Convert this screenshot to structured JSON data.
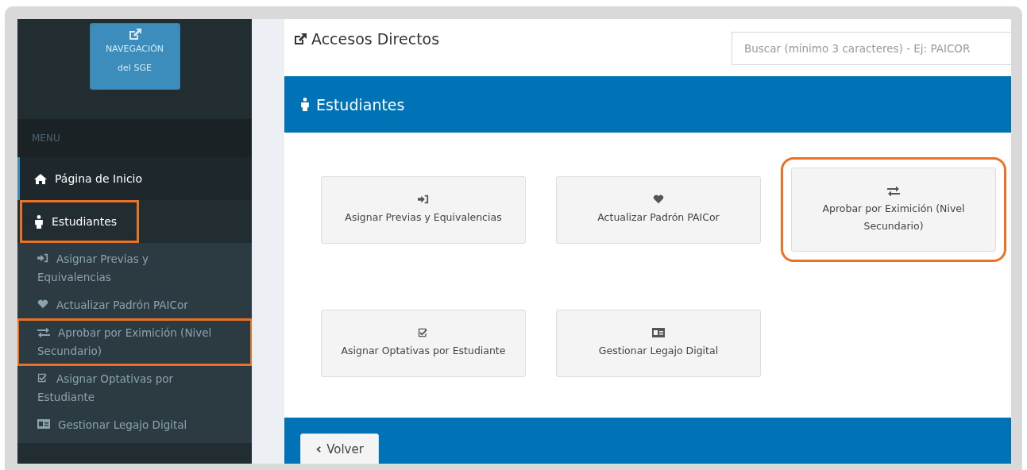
{
  "sidebar": {
    "nav_button": "NAVEGACIÓN del SGE",
    "menu_header": "MENU",
    "items": [
      {
        "label": "Página de Inicio",
        "active": true,
        "highlighted": false
      },
      {
        "label": "Estudiantes",
        "active": false,
        "highlighted": true,
        "children": [
          {
            "label": "Asignar Previas y Equivalencias",
            "highlighted": false
          },
          {
            "label": "Actualizar Padrón PAICor",
            "highlighted": false
          },
          {
            "label": "Aprobar por Eximición (Nivel Secundario)",
            "highlighted": true
          },
          {
            "label": "Asignar Optativas por Estudiante",
            "highlighted": false
          },
          {
            "label": "Gestionar Legajo Digital",
            "highlighted": false
          }
        ]
      }
    ]
  },
  "header": {
    "title": "Accesos Directos",
    "search": {
      "placeholder": "Buscar (mínimo 3 caracteres) - Ej: PAICOR"
    }
  },
  "section": {
    "title": "Estudiantes",
    "cards": [
      {
        "label": "Asignar Previas y Equivalencias",
        "highlighted": false
      },
      {
        "label": "Actualizar Padrón PAICor",
        "highlighted": false
      },
      {
        "label": "Aprobar por Eximición (Nivel Secundario)",
        "highlighted": true
      },
      {
        "label": "Asignar Optativas por Estudiante",
        "highlighted": false
      },
      {
        "label": "Gestionar Legajo Digital",
        "highlighted": false
      }
    ]
  },
  "back_button": "Volver"
}
